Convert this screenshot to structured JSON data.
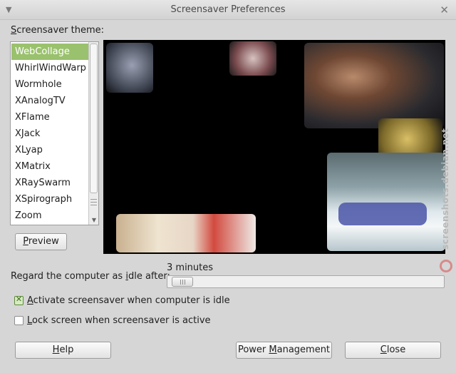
{
  "window": {
    "title": "Screensaver Preferences"
  },
  "theme": {
    "label_mnemonic": "S",
    "label_rest": "creensaver theme:",
    "items": [
      "WebCollage",
      "WhirlWindWarp",
      "Wormhole",
      "XAnalogTV",
      "XFlame",
      "XJack",
      "XLyap",
      "XMatrix",
      "XRaySwarm",
      "XSpirograph",
      "Zoom"
    ],
    "selected_index": 0
  },
  "preview_button": {
    "mnemonic": "P",
    "rest": "review"
  },
  "idle": {
    "label_before": "Regard the computer as ",
    "label_mnemonic": "i",
    "label_after": "dle after:",
    "value": "3 minutes"
  },
  "activate": {
    "mnemonic": "A",
    "rest": "ctivate screensaver when computer is idle",
    "checked": true
  },
  "lock": {
    "mnemonic": "L",
    "rest": "ock screen when screensaver is active",
    "checked": false
  },
  "buttons": {
    "help_mnemonic": "H",
    "help_rest": "elp",
    "power_before": "Power ",
    "power_mnemonic": "M",
    "power_after": "anagement",
    "close_mnemonic": "C",
    "close_rest": "lose"
  },
  "watermark": "screenshots.debian.net"
}
